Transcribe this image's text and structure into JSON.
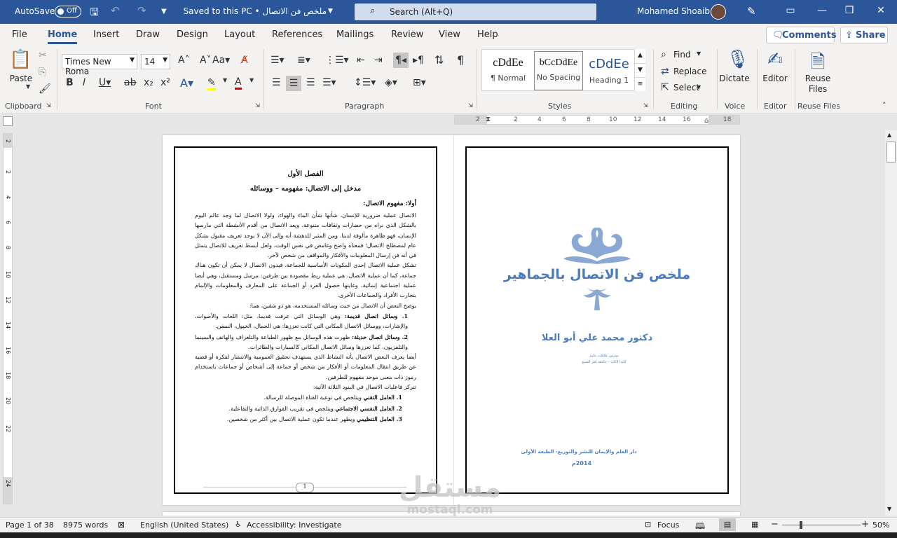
{
  "titlebar": {
    "autosave_label": "AutoSave",
    "autosave_state": "Off",
    "doc_title": "ملخص فن الاتصال • Saved to this PC",
    "search_placeholder": "Search (Alt+Q)",
    "user_name": "Mohamed Shoaib"
  },
  "menu": {
    "tabs": [
      "File",
      "Home",
      "Insert",
      "Draw",
      "Design",
      "Layout",
      "References",
      "Mailings",
      "Review",
      "View",
      "Help"
    ],
    "comments": "Comments",
    "share": "Share"
  },
  "ribbon": {
    "clipboard": {
      "paste": "Paste",
      "label": "Clipboard"
    },
    "font": {
      "name": "Times New Roma",
      "size": "14",
      "label": "Font"
    },
    "paragraph": {
      "label": "Paragraph"
    },
    "styles": {
      "label": "Styles",
      "items": [
        {
          "sample": "cDdEe",
          "name": "¶ Normal"
        },
        {
          "sample": "bCcDdEe",
          "name": "No Spacing"
        },
        {
          "sample": "cDdEe",
          "name": "Heading 1"
        }
      ]
    },
    "editing": {
      "find": "Find",
      "replace": "Replace",
      "select": "Select",
      "label": "Editing"
    },
    "voice": {
      "dictate": "Dictate",
      "label": "Voice"
    },
    "editor": {
      "editor": "Editor",
      "label": "Editor"
    },
    "reuse": {
      "reuse_files": "Reuse Files",
      "label": "Reuse Files"
    }
  },
  "ruler": {
    "ticks": [
      "2",
      "2",
      "4",
      "6",
      "8",
      "10",
      "12",
      "14",
      "16",
      "18"
    ]
  },
  "vruler": {
    "ticks": [
      "2",
      "2",
      "4",
      "6",
      "8",
      "10",
      "12",
      "14",
      "16",
      "18",
      "20",
      "22",
      "24"
    ]
  },
  "page1": {
    "chapter": "الفصل الأول",
    "subtitle": "مدخل إلى الاتصال: مفهومه – ووسائله",
    "section": "أولا: مفهوم الاتصال:",
    "para1": "الاتصال عملية ضرورية للإنسان، شأنها شأن الماء والهواء، ولولا الاتصال لما وجد عالم اليوم بالشكل الذي نراه من حضارات وثقافات متنوعة، ويعد الاتصال من أقدم الأنشطة التي مارسها الإنسان، فهو ظاهرة مألوفة لدينا. ومن المثير للدهشة أنه وإلى الآن لا يوجد تعريف مقبول بشكل عام لمصطلح الاتصال؛ فمعناه واضح وغامض في نفس الوقت، ولعل أبسط تعريف للاتصال يتمثل في أنه فن إرسال المعلومات والأفكار والمواقف من شخص لآخر.",
    "para2": "تشكل عملية الاتصال إحدى المكونات الأساسية للجماعة، فبدون الاتصال لا يمكن أن تكون هناك جماعة، كما أن عملية الاتصال، هي عملية ربط مقصودة بين طرفين: مرسل ومستقبل، وهي أيضا عملية اجتماعية إنمائية، وغايتها حصول الفرد أو الجماعة على المعارف والمعلومات والإلمام بتجارب الأفراد والجماعات الأخرى.",
    "para3": "يوضح البعض أن الاتصال من حيث وسائله المستخدمة، هو ذو شقين، هما:",
    "item1_title": "1. وسائل اتصال قديمة:",
    "item1_text": " وهي الوسائل التي عرفت قديما، مثل: اللغات والأصوات، والإشارات، ووسائل الاتصال المكاني التي كانت تعززها: هي الجمال، الخيول، السفن.",
    "item2_title": "2. وسائل اتصال حديثة:",
    "item2_text": " ظهرت هذه الوسائل مع ظهور الطباعة والتلغراف والهاتف والسينما والتلفزيون، كما تعززها وسائل الاتصال المكاني كالسيارات والطائرات.",
    "para4": "أيضا يعرف البعض الاتصال بأنه النشاط الذي يستهدف تحقيق العمومية والانتشار لفكرة أو قضية عن طريق انتقال المعلومات أو الأفكار من شخص أو جماعة إلى أشخاص أو جماعات باستخدام رموز ذات معنى موحد مفهوم للطرفين.",
    "para5": "تتركز فاعليات الاتصال في البنود الثلاثة الآتية:",
    "factor1_title": "1. العامل التقني",
    "factor1_text": " ويتلخص في نوعية القناة الموصلة للرسالة.",
    "factor2_title": "2. العامل النفسي الاجتماعي",
    "factor2_text": " ويتلخص في تقريب الفوارق الذاتية والتفاعلية.",
    "factor3_title": "3. العامل التنظيمي",
    "factor3_text": " ويظهر عندما تكون عملية الاتصال بين أكثر من شخصين.",
    "page_number": "1"
  },
  "page2": {
    "title": "ملخص فن الاتصال بالجماهير",
    "author": "دكتور محمد علي أبو العلا",
    "role1": "مدرس علاقات عامة",
    "role2": "كلية الآداب – جامعة كفر الشيخ",
    "publisher": "دار العلم والإيمان للنشر والتوزيع- الطبعة الأولى",
    "year": "2014م"
  },
  "watermark": {
    "arabic": "مستقل",
    "latin": "mostaql.com"
  },
  "status": {
    "page": "Page 1 of 38",
    "words": "8975 words",
    "language": "English (United States)",
    "accessibility": "Accessibility: Investigate",
    "focus": "Focus",
    "zoom": "50%"
  },
  "colors": {
    "accent": "#2b579a",
    "cover_blue": "#4a7bbf",
    "ornament": "#8aa8d4"
  }
}
